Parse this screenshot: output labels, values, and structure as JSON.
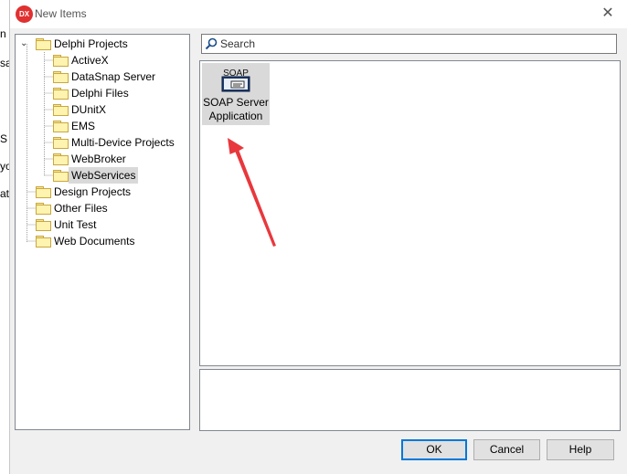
{
  "background_window": {
    "fragments": [
      "n",
      "sa",
      "S",
      "yo",
      "at"
    ]
  },
  "dialog": {
    "title": "New Items",
    "logo_text": "DX",
    "close_glyph": "✕"
  },
  "tree": {
    "root": {
      "label": "Delphi Projects",
      "expanded": true
    },
    "children": [
      {
        "label": "ActiveX"
      },
      {
        "label": "DataSnap Server"
      },
      {
        "label": "Delphi Files"
      },
      {
        "label": "DUnitX"
      },
      {
        "label": "EMS"
      },
      {
        "label": "Multi-Device Projects"
      },
      {
        "label": "WebBroker"
      },
      {
        "label": "WebServices",
        "selected": true
      }
    ],
    "top_level": [
      {
        "label": "Design Projects"
      },
      {
        "label": "Other Files"
      },
      {
        "label": "Unit Test"
      },
      {
        "label": "Web Documents"
      }
    ]
  },
  "search": {
    "placeholder": "Search",
    "value": ""
  },
  "items": [
    {
      "label": "SOAP Server\nApplication",
      "icon_text": "SOAP",
      "icon": "soap-server-icon"
    }
  ],
  "buttons": {
    "ok": "OK",
    "cancel": "Cancel",
    "help": "Help"
  },
  "colors": {
    "annotation_arrow": "#e8383d",
    "selection": "#d9d9d9",
    "default_button_border": "#0078d7",
    "logo": "#e03030"
  }
}
